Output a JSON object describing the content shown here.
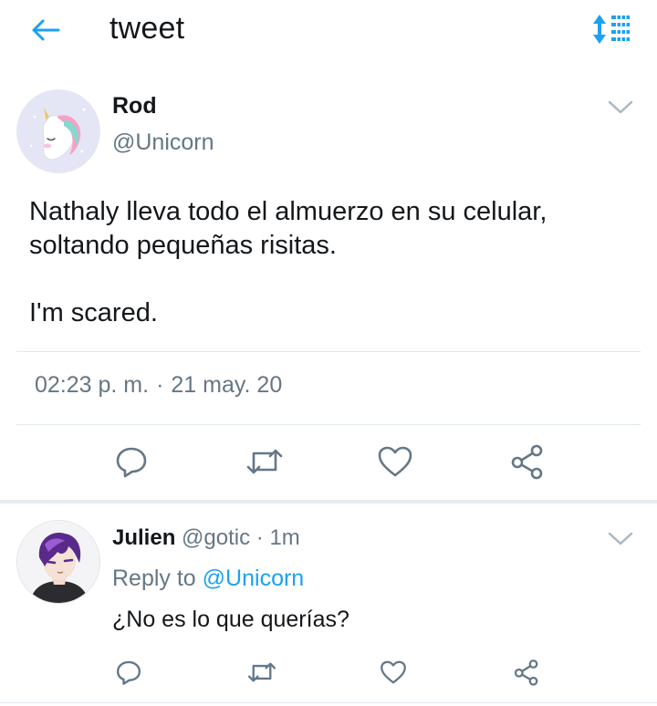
{
  "header": {
    "title": "tweet",
    "back_icon": "arrow-left-icon",
    "sort_icon": "sort-list-icon",
    "accent_color": "#1da1f2"
  },
  "tweet": {
    "author_name": "Rod",
    "author_handle": "@Unicorn",
    "avatar": "unicorn-avatar",
    "text_lines": [
      "Nathaly lleva todo el almuerzo en su celular,",
      "soltando pequeñas risitas."
    ],
    "text_line_2": "I'm scared.",
    "time": "02:23 p. m.",
    "separator": "·",
    "date": "21 may. 20",
    "actions": [
      "reply-icon",
      "retweet-icon",
      "like-icon",
      "share-icon"
    ]
  },
  "reply": {
    "author_name": "Julien",
    "author_handle": "@gotic",
    "age_separator": "·",
    "age": "1m",
    "reply_to_label": "Reply to",
    "reply_to_handle": "@Unicorn",
    "text": "¿No es lo que querías?",
    "avatar": "anime-boy-avatar",
    "actions": [
      "reply-icon",
      "retweet-icon",
      "like-icon",
      "share-icon"
    ]
  },
  "colors": {
    "text": "#14171a",
    "muted": "#657786",
    "divider": "#e1e8ed"
  }
}
